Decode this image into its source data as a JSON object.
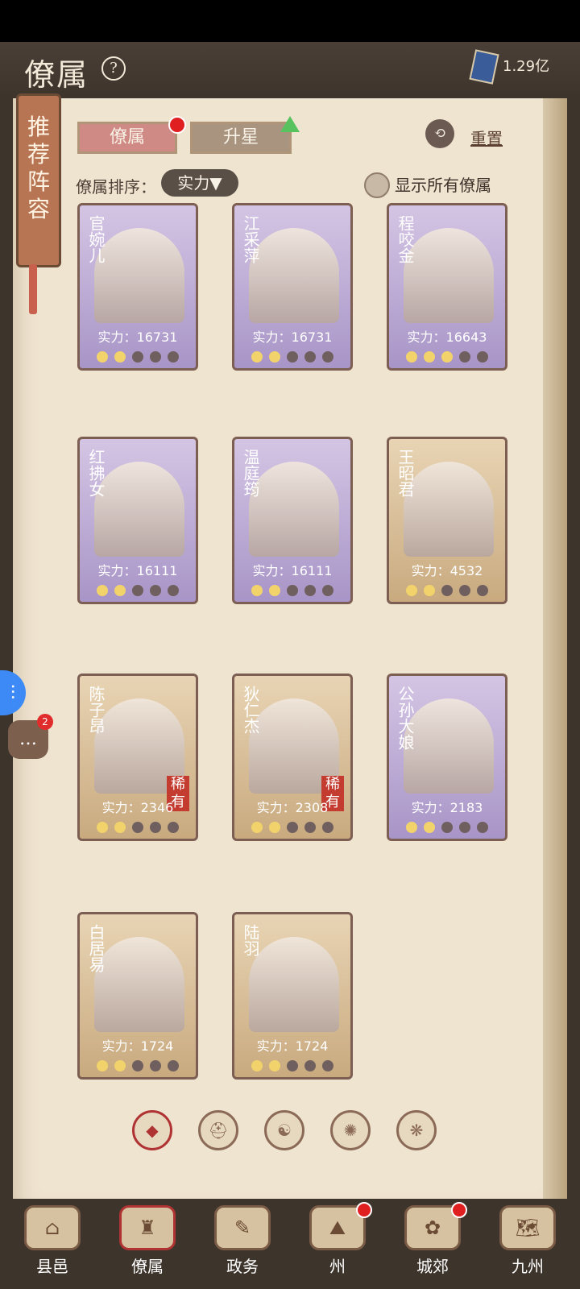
{
  "header": {
    "title": "僚属",
    "help_icon": "?",
    "currency_value": "1.29亿"
  },
  "banner": {
    "text": "推荐阵容"
  },
  "tabs": [
    {
      "label": "僚属",
      "active": true,
      "badge": true
    },
    {
      "label": "升星",
      "active": false,
      "arrow": true
    }
  ],
  "reset_label": "重置",
  "sort": {
    "label": "僚属排序：",
    "value": "实力▼"
  },
  "toggle_label": "显示所有僚属",
  "cards": [
    {
      "name": "官婉儿",
      "power": "实力：16731",
      "rare": false,
      "style": "purple",
      "stars": [
        1,
        1,
        0,
        0,
        0
      ]
    },
    {
      "name": "江采萍",
      "power": "实力：16731",
      "rare": false,
      "style": "purple",
      "stars": [
        1,
        1,
        0,
        0,
        0
      ]
    },
    {
      "name": "程咬金",
      "power": "实力：16643",
      "rare": false,
      "style": "purple",
      "stars": [
        1,
        1,
        1,
        0,
        0
      ]
    },
    {
      "name": "红拂女",
      "power": "实力：16111",
      "rare": false,
      "style": "purple",
      "stars": [
        1,
        1,
        0,
        0,
        0
      ]
    },
    {
      "name": "温庭筠",
      "power": "实力：16111",
      "rare": false,
      "style": "purple",
      "stars": [
        1,
        1,
        0,
        0,
        0
      ]
    },
    {
      "name": "王昭君",
      "power": "实力：4532",
      "rare": false,
      "style": "tan",
      "stars": [
        1,
        1,
        0,
        0,
        0
      ]
    },
    {
      "name": "陈子昂",
      "power": "实力：2346",
      "rare": true,
      "rare_label": "稀有",
      "style": "tan",
      "stars": [
        1,
        1,
        0,
        0,
        0
      ]
    },
    {
      "name": "狄仁杰",
      "power": "实力：2308",
      "rare": true,
      "rare_label": "稀有",
      "style": "tan",
      "stars": [
        1,
        1,
        0,
        0,
        0
      ]
    },
    {
      "name": "公孙大娘",
      "power": "实力：2183",
      "rare": false,
      "style": "purple",
      "stars": [
        1,
        1,
        0,
        0,
        0
      ]
    },
    {
      "name": "白居易",
      "power": "实力：1724",
      "rare": false,
      "style": "tan",
      "stars": [
        1,
        1,
        0,
        0,
        0
      ]
    },
    {
      "name": "陆羽",
      "power": "实力：1724",
      "rare": false,
      "style": "tan",
      "stars": [
        1,
        1,
        0,
        0,
        0
      ]
    }
  ],
  "pager": [
    {
      "icon": "diamond-icon",
      "active": true
    },
    {
      "icon": "helmet-icon",
      "active": false
    },
    {
      "icon": "gourd-icon",
      "active": false
    },
    {
      "icon": "fan-icon",
      "active": false
    },
    {
      "icon": "beast-icon",
      "active": false
    }
  ],
  "side": {
    "chat_badge": "2"
  },
  "bottom_nav": [
    {
      "label": "县邑",
      "active": false,
      "badge": false
    },
    {
      "label": "僚属",
      "active": true,
      "badge": false
    },
    {
      "label": "政务",
      "active": false,
      "badge": false
    },
    {
      "label": "州",
      "active": false,
      "badge": true
    },
    {
      "label": "城郊",
      "active": false,
      "badge": true
    },
    {
      "label": "九州",
      "active": false,
      "badge": false
    }
  ]
}
